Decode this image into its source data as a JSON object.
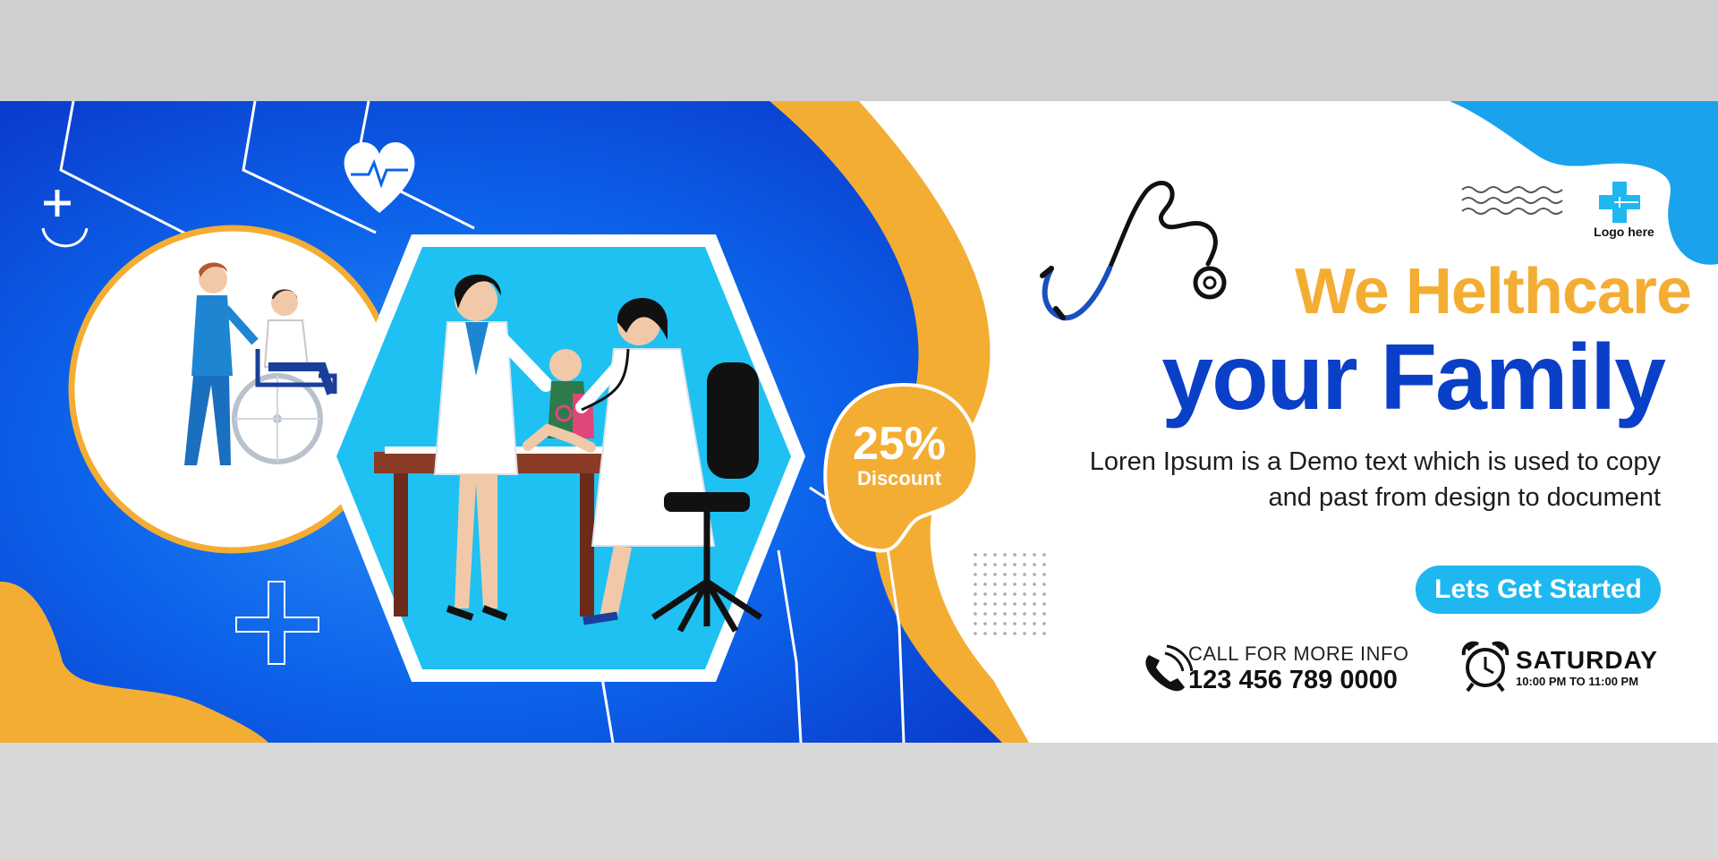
{
  "headline": {
    "line1": "We Helthcare",
    "line2": "your Family"
  },
  "description": {
    "line1": "Loren Ipsum is a Demo text which is used to copy",
    "line2": "and past from design to document"
  },
  "cta": {
    "label": "Lets Get Started"
  },
  "contact": {
    "label": "CALL FOR MORE INFO",
    "number": "123 456 789 0000"
  },
  "schedule": {
    "day": "SATURDAY",
    "time": "10:00 PM TO 11:00 PM"
  },
  "discount": {
    "percent": "25%",
    "label": "Discount"
  },
  "logo": {
    "text": "Logo here"
  },
  "colors": {
    "blue_dark": "#0a3fc7",
    "blue_light": "#1fb7ef",
    "orange": "#f4ad33",
    "white": "#ffffff"
  },
  "icons": [
    "plus-icon",
    "heart-pulse-icon",
    "stethoscope-icon",
    "wavy-lines-icon",
    "medical-cross-logo-icon",
    "phone-icon",
    "alarm-clock-icon",
    "dot-grid-icon",
    "outline-cross-icon"
  ]
}
